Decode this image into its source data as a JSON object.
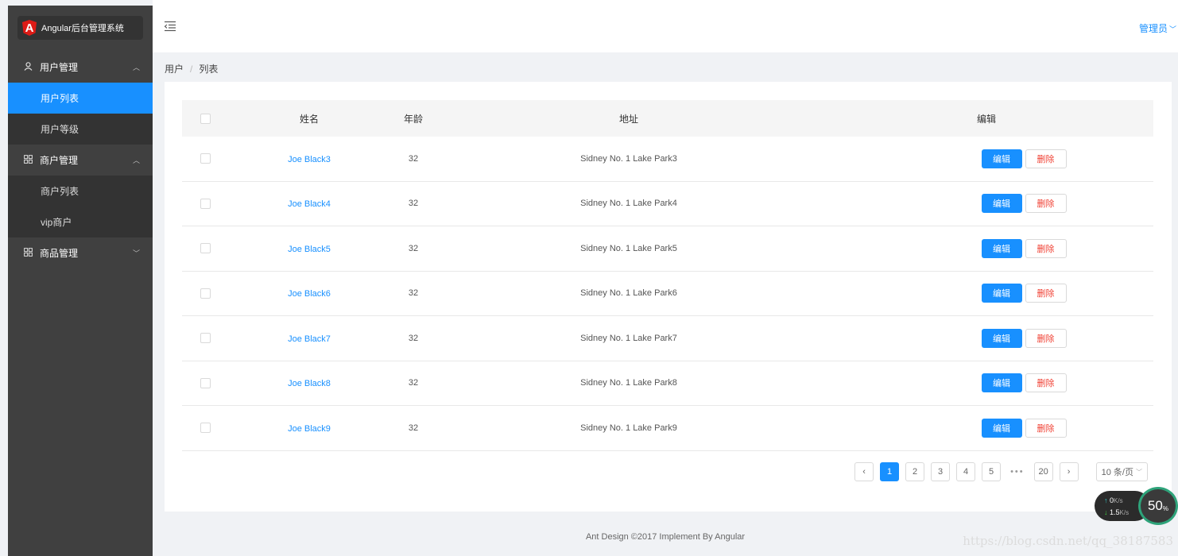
{
  "app": {
    "logo_letter": "A",
    "title": "Angular后台管理系统"
  },
  "sidebar": {
    "groups": [
      {
        "label": "用户管理",
        "icon": "user-icon",
        "expanded": true,
        "items": [
          {
            "label": "用户列表",
            "active": true
          },
          {
            "label": "用户等级",
            "active": false
          }
        ]
      },
      {
        "label": "商户管理",
        "icon": "shop-icon",
        "expanded": true,
        "items": [
          {
            "label": "商户列表",
            "active": false
          },
          {
            "label": "vip商户",
            "active": false
          }
        ]
      },
      {
        "label": "商品管理",
        "icon": "goods-icon",
        "expanded": false,
        "items": []
      }
    ]
  },
  "header": {
    "admin_label": "管理员"
  },
  "breadcrumb": {
    "items": [
      "用户",
      "列表"
    ]
  },
  "table": {
    "columns": [
      "姓名",
      "年龄",
      "地址",
      "编辑"
    ],
    "rows": [
      {
        "name": "Joe Black3",
        "age": "32",
        "address": "Sidney No. 1 Lake Park3"
      },
      {
        "name": "Joe Black4",
        "age": "32",
        "address": "Sidney No. 1 Lake Park4"
      },
      {
        "name": "Joe Black5",
        "age": "32",
        "address": "Sidney No. 1 Lake Park5"
      },
      {
        "name": "Joe Black6",
        "age": "32",
        "address": "Sidney No. 1 Lake Park6"
      },
      {
        "name": "Joe Black7",
        "age": "32",
        "address": "Sidney No. 1 Lake Park7"
      },
      {
        "name": "Joe Black8",
        "age": "32",
        "address": "Sidney No. 1 Lake Park8"
      },
      {
        "name": "Joe Black9",
        "age": "32",
        "address": "Sidney No. 1 Lake Park9"
      }
    ],
    "edit_label": "编辑",
    "delete_label": "删除"
  },
  "pagination": {
    "prev": "‹",
    "next": "›",
    "pages": [
      "1",
      "2",
      "3",
      "4",
      "5"
    ],
    "current": "1",
    "ellipsis": "•••",
    "last": "20",
    "page_size": "10 条/页"
  },
  "footer": {
    "text": "Ant Design ©2017 Implement By Angular"
  },
  "watermark": "https://blog.csdn.net/qq_38187583",
  "net_monitor": {
    "up": "0",
    "up_unit": "K/s",
    "down": "1.5",
    "down_unit": "K/s",
    "percent": "50",
    "percent_sign": "%"
  },
  "colors": {
    "primary": "#1890ff",
    "danger": "#f04134",
    "sidebar": "#404040",
    "submenu": "#333333"
  }
}
